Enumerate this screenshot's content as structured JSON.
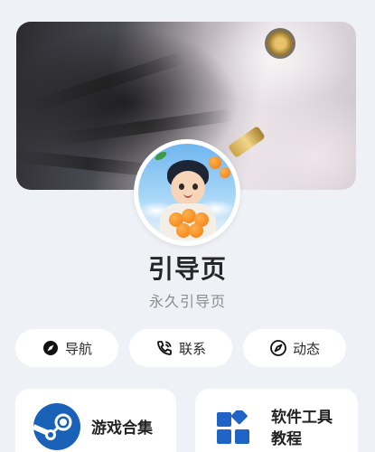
{
  "profile": {
    "title": "引导页",
    "subtitle": "永久引导页"
  },
  "nav_buttons": [
    {
      "label": "导航",
      "icon": "compass-icon"
    },
    {
      "label": "联系",
      "icon": "phone-icon"
    },
    {
      "label": "动态",
      "icon": "dynamic-compass-icon"
    }
  ],
  "cards": [
    {
      "label": "游戏合集",
      "icon": "steam-icon"
    },
    {
      "label": "软件工具教程",
      "icon": "app-grid-icon"
    }
  ],
  "colors": {
    "background": "#eef2f7",
    "steam_blue": "#1a62b8",
    "grid_blue": "#1e63c5"
  }
}
